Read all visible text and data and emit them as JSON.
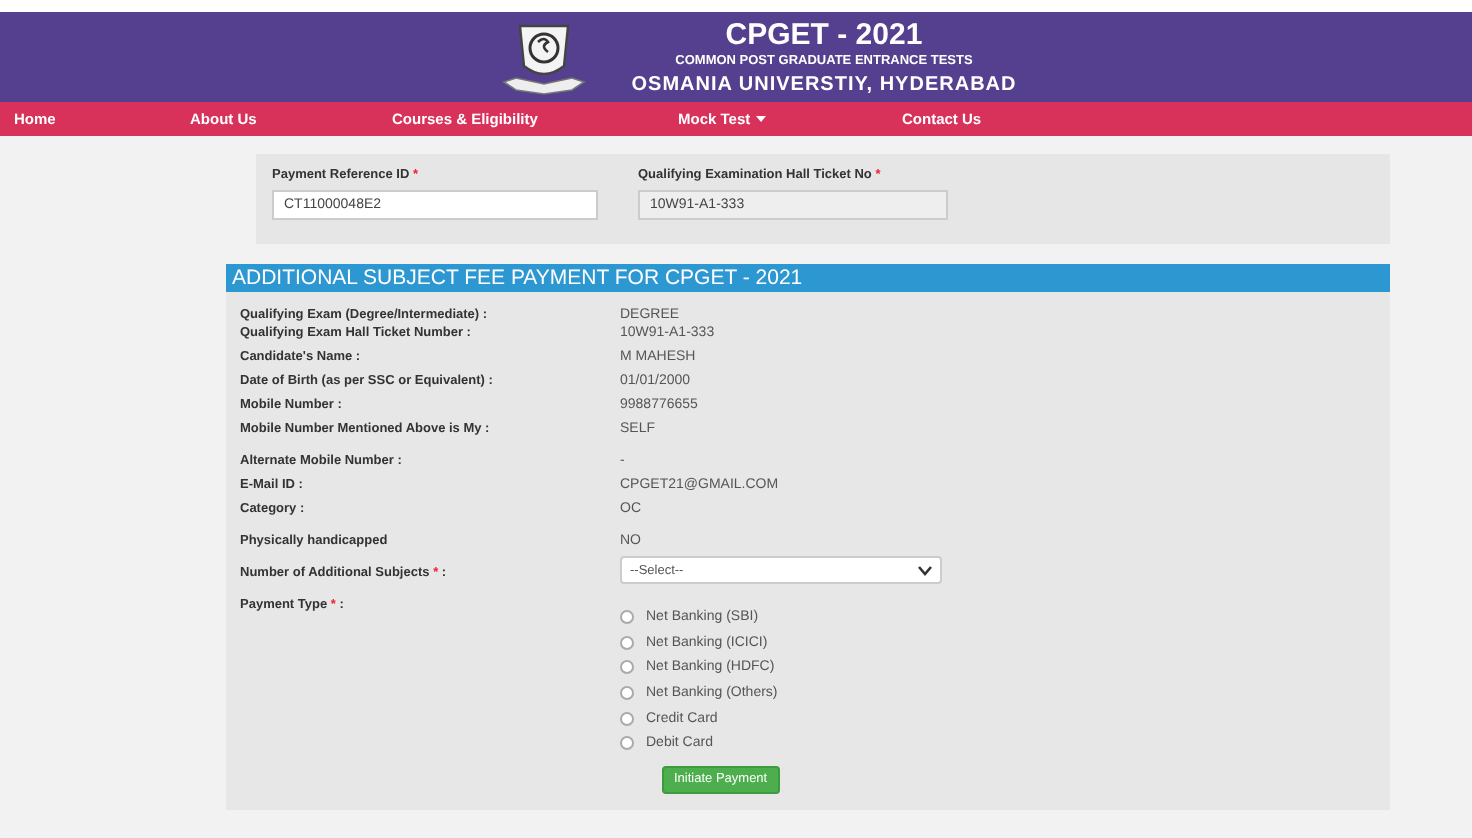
{
  "header": {
    "title": "CPGET - 2021",
    "subtitle": "COMMON POST GRADUATE ENTRANCE TESTS",
    "university": "OSMANIA UNIVERSTIY, HYDERABAD"
  },
  "nav": [
    {
      "label": "Home",
      "has_menu": false
    },
    {
      "label": "About Us",
      "has_menu": false
    },
    {
      "label": "Courses & Eligibility",
      "has_menu": false
    },
    {
      "label": "Mock Test",
      "has_menu": true
    },
    {
      "label": "Contact Us",
      "has_menu": false
    }
  ],
  "top_fields": [
    {
      "label": "Payment Reference ID",
      "required_mark": "*",
      "value": "CT11000048E2",
      "disabled": false
    },
    {
      "label": "Qualifying Examination Hall Ticket No",
      "required_mark": "*",
      "value": "10W91-A1-333",
      "disabled": true
    }
  ],
  "section_title": "ADDITIONAL SUBJECT FEE PAYMENT FOR CPGET - 2021",
  "details": [
    {
      "label": "Qualifying Exam (Degree/Intermediate) :",
      "value": "DEGREE"
    },
    {
      "label": "Qualifying Exam Hall Ticket Number :",
      "value": "10W91-A1-333"
    },
    {
      "label": "Candidate's Name :",
      "value": "M MAHESH"
    },
    {
      "label": "Date of Birth (as per SSC or Equivalent) :",
      "value": "01/01/2000"
    },
    {
      "label": "Mobile Number :",
      "value": "9988776655"
    },
    {
      "label": "Mobile Number Mentioned Above is My :",
      "value": "SELF"
    },
    {
      "label": "Alternate Mobile Number :",
      "value": "-"
    },
    {
      "label": "E-Mail ID :",
      "value": "CPGET21@GMAIL.COM"
    },
    {
      "label": "Category :",
      "value": "OC"
    },
    {
      "label": "Physically handicapped",
      "value": "NO"
    }
  ],
  "subjects": {
    "label": "Number of Additional Subjects",
    "required_mark": "*",
    "suffix": ":",
    "value": "--Select--"
  },
  "payment": {
    "label": "Payment Type",
    "required_mark": "*",
    "suffix": ":",
    "options": [
      {
        "label": "Net Banking (SBI)",
        "selected": false
      },
      {
        "label": "Net Banking (ICICI)",
        "selected": false
      },
      {
        "label": "Net Banking (HDFC)",
        "selected": false
      },
      {
        "label": "Net Banking (Others)",
        "selected": false
      },
      {
        "label": "Credit Card",
        "selected": false
      },
      {
        "label": "Debit Card",
        "selected": false
      }
    ]
  },
  "submit": "Initiate Payment"
}
